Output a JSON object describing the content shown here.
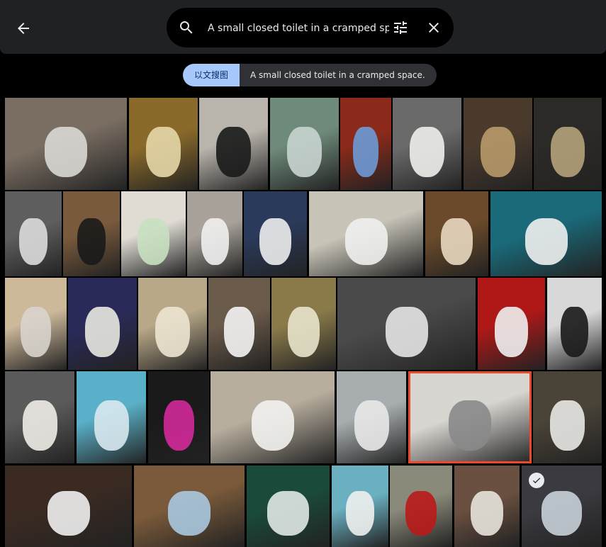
{
  "header": {
    "back_icon": "arrow-back-icon",
    "search_icon": "search-icon",
    "search_value": "A small closed toilet in a cramped space.",
    "filter_icon": "tune-sliders-icon",
    "clear_icon": "close-icon"
  },
  "chips": {
    "mode_label": "以文搜图",
    "query_label": "A small closed toilet in a cramped space."
  },
  "results": {
    "selected_index": 29,
    "checked_index": 37
  }
}
